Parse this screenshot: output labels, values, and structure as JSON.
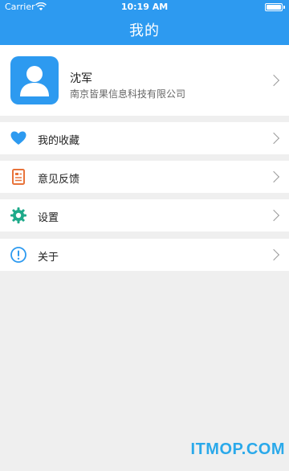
{
  "status_bar": {
    "carrier": "Carrier",
    "time": "10:19 AM",
    "battery_level": 1.0
  },
  "header": {
    "title": "我的"
  },
  "profile": {
    "name": "沈军",
    "company": "南京皆果信息科技有限公司"
  },
  "menu": {
    "items": [
      {
        "label": "我的收藏",
        "icon": "heart-icon"
      },
      {
        "label": "意见反馈",
        "icon": "feedback-doc-icon"
      },
      {
        "label": "设置",
        "icon": "gear-icon"
      },
      {
        "label": "关于",
        "icon": "info-icon"
      }
    ]
  },
  "watermark": "ITMOP.COM",
  "colors": {
    "primary": "#2d9af0",
    "background": "#efefef",
    "feedback_icon": "#e8733a",
    "settings_icon": "#1eaa8a",
    "about_icon": "#2d9af0",
    "watermark": "#2aa9ea"
  }
}
